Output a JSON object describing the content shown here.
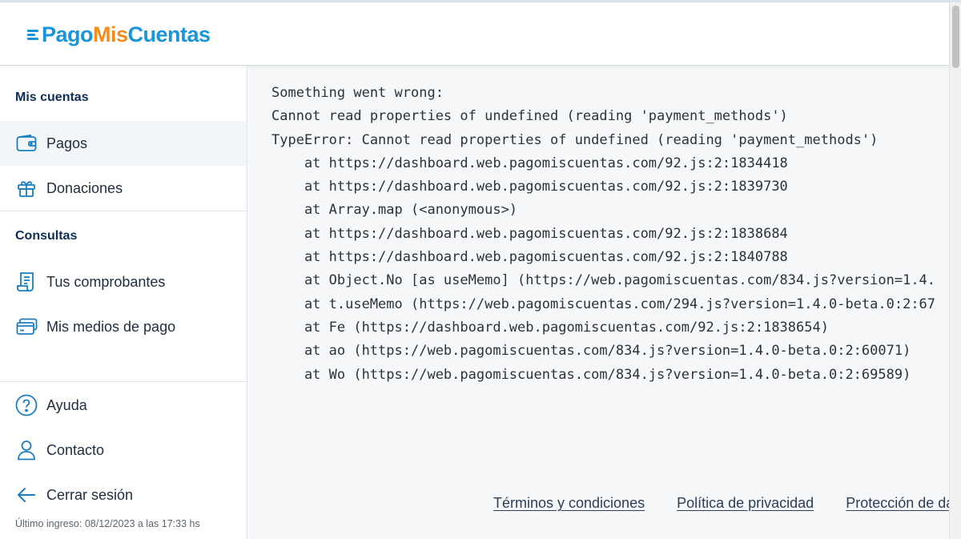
{
  "brand": {
    "logo_part1": "Pago",
    "logo_part2": "Mis",
    "logo_part3": "Cuentas",
    "colors": {
      "blue": "#1a95d9",
      "orange": "#f28c1a",
      "navy": "#0f2e57"
    }
  },
  "sidebar": {
    "section_accounts": "Mis cuentas",
    "payments": {
      "label": "Pagos",
      "icon": "wallet-icon"
    },
    "donations": {
      "label": "Donaciones",
      "icon": "gift-icon"
    },
    "section_queries": "Consultas",
    "receipts": {
      "label": "Tus comprobantes",
      "icon": "receipt-icon"
    },
    "payment_methods": {
      "label": "Mis medios de pago",
      "icon": "credit-card-icon"
    },
    "help": {
      "label": "Ayuda",
      "icon": "help-circle-icon"
    },
    "contact": {
      "label": "Contacto",
      "icon": "user-icon"
    },
    "logout": {
      "label": "Cerrar sesión",
      "icon": "arrow-left-icon"
    },
    "last_login": "Último ingreso: 08/12/2023 a las 17:33 hs"
  },
  "error": {
    "lines": [
      "Something went wrong:",
      "Cannot read properties of undefined (reading 'payment_methods')",
      "TypeError: Cannot read properties of undefined (reading 'payment_methods')",
      "    at https://dashboard.web.pagomiscuentas.com/92.js:2:1834418",
      "    at https://dashboard.web.pagomiscuentas.com/92.js:2:1839730",
      "    at Array.map (<anonymous>)",
      "    at https://dashboard.web.pagomiscuentas.com/92.js:2:1838684",
      "    at https://dashboard.web.pagomiscuentas.com/92.js:2:1840788",
      "    at Object.No [as useMemo] (https://web.pagomiscuentas.com/834.js?version=1.4.",
      "    at t.useMemo (https://web.pagomiscuentas.com/294.js?version=1.4.0-beta.0:2:67",
      "    at Fe (https://dashboard.web.pagomiscuentas.com/92.js:2:1838654)",
      "    at ao (https://web.pagomiscuentas.com/834.js?version=1.4.0-beta.0:2:60071)",
      "    at Wo (https://web.pagomiscuentas.com/834.js?version=1.4.0-beta.0:2:69589)"
    ]
  },
  "footer": {
    "terms": "Términos y condiciones",
    "privacy": "Política de privacidad",
    "data_protection": "Protección de datos"
  }
}
